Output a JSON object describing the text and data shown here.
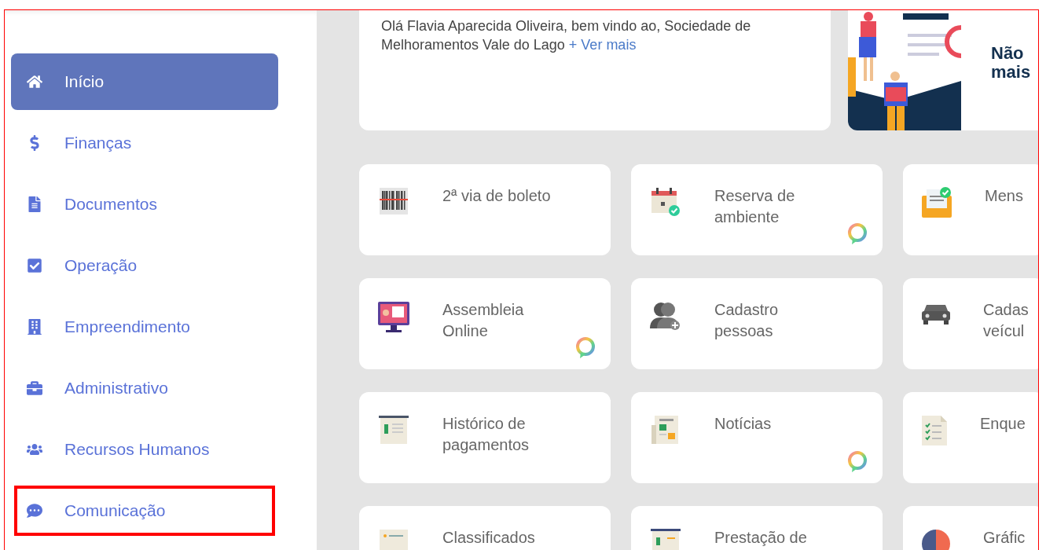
{
  "sidebar": {
    "items": [
      {
        "label": "Início",
        "selected": true,
        "highlighted": false
      },
      {
        "label": "Finanças",
        "selected": false,
        "highlighted": false
      },
      {
        "label": "Documentos",
        "selected": false,
        "highlighted": false
      },
      {
        "label": "Operação",
        "selected": false,
        "highlighted": false
      },
      {
        "label": "Empreendimento",
        "selected": false,
        "highlighted": false
      },
      {
        "label": "Administrativo",
        "selected": false,
        "highlighted": false
      },
      {
        "label": "Recursos Humanos",
        "selected": false,
        "highlighted": false
      },
      {
        "label": "Comunicação",
        "selected": false,
        "highlighted": true
      }
    ]
  },
  "welcome": {
    "text": "Olá Flavia Aparecida Oliveira, bem vindo ao, Sociedade de Melhoramentos Vale do Lago",
    "link": "+ Ver mais"
  },
  "banner": {
    "lines": [
      "Não",
      "mais"
    ]
  },
  "tiles": [
    {
      "label": "2ª via de boleto",
      "chat_badge": false
    },
    {
      "label": "Reserva de ambiente",
      "chat_badge": true
    },
    {
      "label": "Mens",
      "chat_badge": false
    },
    {
      "label": "Assembleia Online",
      "chat_badge": true
    },
    {
      "label": "Cadastro pessoas",
      "chat_badge": false
    },
    {
      "label": "Cadas veícul",
      "chat_badge": false
    },
    {
      "label": "Histórico de pagamentos",
      "chat_badge": false
    },
    {
      "label": "Notícias",
      "chat_badge": true
    },
    {
      "label": "Enque",
      "chat_badge": false
    },
    {
      "label": "Classificados"
    },
    {
      "label": "Prestação de"
    },
    {
      "label": "Gráfic"
    }
  ]
}
